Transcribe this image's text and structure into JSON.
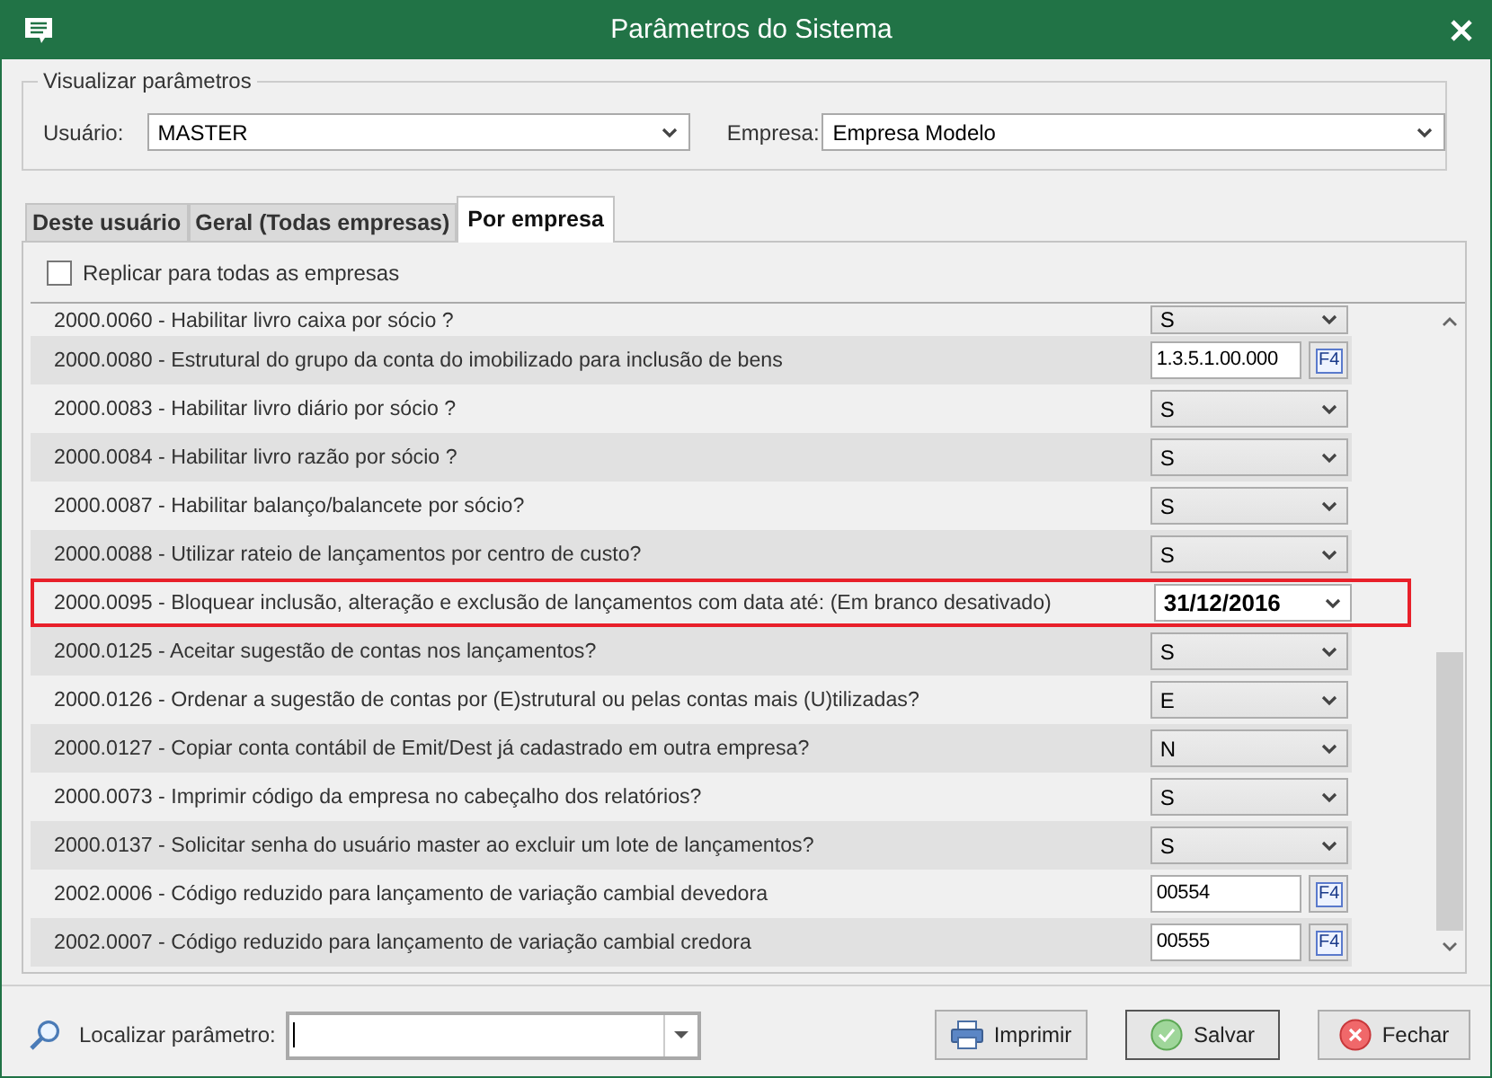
{
  "window": {
    "title": "Parâmetros do Sistema"
  },
  "filter": {
    "legend": "Visualizar parâmetros",
    "user_label": "Usuário:",
    "user_value": "MASTER",
    "company_label": "Empresa:",
    "company_value": "Empresa Modelo"
  },
  "tabs": [
    {
      "label": "Deste usuário",
      "selected": false
    },
    {
      "label": "Geral (Todas empresas)",
      "selected": false
    },
    {
      "label": "Por empresa",
      "selected": true
    }
  ],
  "replicate": {
    "label": "Replicar para todas as empresas",
    "checked": false
  },
  "parameters": [
    {
      "label": "2000.0060 - Habilitar livro caixa por sócio ?",
      "kind": "select",
      "value": "S",
      "highlighted": false
    },
    {
      "label": "2000.0080 - Estrutural do grupo da conta do imobilizado para inclusão de bens",
      "kind": "lookup",
      "value": "1.3.5.1.00.000",
      "button": "F4",
      "highlighted": false
    },
    {
      "label": "2000.0083 - Habilitar livro diário por sócio ?",
      "kind": "select",
      "value": "S",
      "highlighted": false
    },
    {
      "label": "2000.0084 - Habilitar livro razão por sócio ?",
      "kind": "select",
      "value": "S",
      "highlighted": false
    },
    {
      "label": "2000.0087 - Habilitar balanço/balancete por sócio?",
      "kind": "select",
      "value": "S",
      "highlighted": false
    },
    {
      "label": "2000.0088 - Utilizar rateio de lançamentos por centro de custo?",
      "kind": "select",
      "value": "S",
      "highlighted": false
    },
    {
      "label": "2000.0095 - Bloquear inclusão, alteração e exclusão de lançamentos com data até: (Em branco desativado)",
      "kind": "date",
      "value": "31/12/2016",
      "highlighted": true
    },
    {
      "label": "2000.0125 - Aceitar sugestão de contas nos lançamentos?",
      "kind": "select",
      "value": "S",
      "highlighted": false
    },
    {
      "label": "2000.0126 - Ordenar a sugestão de contas por (E)strutural ou pelas contas mais (U)tilizadas?",
      "kind": "select",
      "value": "E",
      "highlighted": false
    },
    {
      "label": "2000.0127 - Copiar conta contábil de Emit/Dest já cadastrado em outra empresa?",
      "kind": "select",
      "value": "N",
      "highlighted": false
    },
    {
      "label": "2000.0073 - Imprimir código da empresa no cabeçalho dos relatórios?",
      "kind": "select",
      "value": "S",
      "highlighted": false
    },
    {
      "label": "2000.0137 - Solicitar senha do usuário master ao excluir um lote de lançamentos?",
      "kind": "select",
      "value": "S",
      "highlighted": false
    },
    {
      "label": "2002.0006 - Código reduzido para lançamento de variação cambial devedora",
      "kind": "lookup",
      "value": "00554",
      "button": "F4",
      "highlighted": false
    },
    {
      "label": "2002.0007 - Código reduzido para lançamento de variação cambial credora",
      "kind": "lookup",
      "value": "00555",
      "button": "F4",
      "highlighted": false
    }
  ],
  "footer": {
    "search_label": "Localizar parâmetro:",
    "buttons": [
      {
        "label": "Imprimir",
        "kind": "print"
      },
      {
        "label": "Salvar",
        "kind": "save"
      },
      {
        "label": "Fechar",
        "kind": "close"
      }
    ]
  }
}
